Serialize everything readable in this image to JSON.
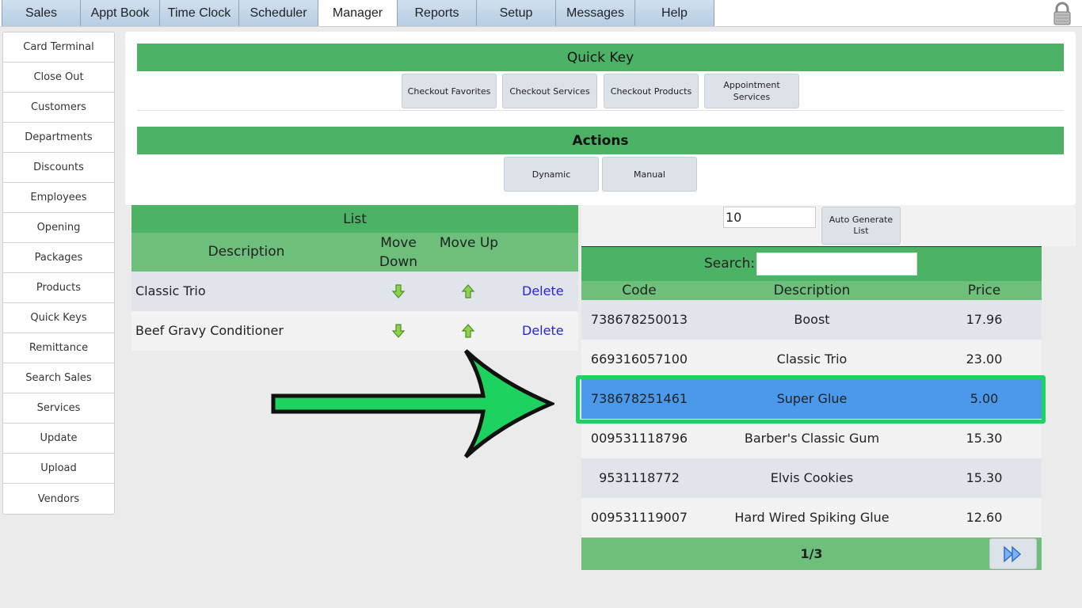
{
  "tabs": [
    "Sales",
    "Appt Book",
    "Time Clock",
    "Scheduler",
    "Manager",
    "Reports",
    "Setup",
    "Messages",
    "Help"
  ],
  "active_tab": "Manager",
  "sidebar": [
    "Card Terminal",
    "Close Out",
    "Customers",
    "Departments",
    "Discounts",
    "Employees",
    "Opening",
    "Packages",
    "Products",
    "Quick Keys",
    "Remittance",
    "Search Sales",
    "Services",
    "Update",
    "Upload",
    "Vendors"
  ],
  "quick_key": {
    "title": "Quick Key",
    "buttons": [
      "Checkout Favorites",
      "Checkout Services",
      "Checkout Products",
      "Appointment Services"
    ]
  },
  "actions": {
    "title": "Actions",
    "buttons": [
      "Dynamic",
      "Manual"
    ]
  },
  "list": {
    "title": "List",
    "col_description": "Description",
    "col_move_down": "Move Down",
    "col_move_up": "Move Up",
    "delete_label": "Delete",
    "rows": [
      "Classic Trio",
      "Beef Gravy Conditioner"
    ]
  },
  "generator": {
    "count_value": "10",
    "button": "Auto Generate List"
  },
  "products": {
    "search_label": "Search:",
    "search_value": "",
    "col_code": "Code",
    "col_description": "Description",
    "col_price": "Price",
    "rows": [
      {
        "code": "738678250013",
        "description": "Boost",
        "price": "17.96"
      },
      {
        "code": "669316057100",
        "description": "Classic Trio",
        "price": "23.00"
      },
      {
        "code": "738678251461",
        "description": "Super Glue",
        "price": "5.00"
      },
      {
        "code": "009531118796",
        "description": "Barber's Classic Gum",
        "price": "15.30"
      },
      {
        "code": "9531118772",
        "description": "Elvis Cookies",
        "price": "15.30"
      },
      {
        "code": "009531119007",
        "description": "Hard Wired Spiking Glue",
        "price": "12.60"
      }
    ],
    "selected_index": 2,
    "page": "1/3"
  },
  "colors": {
    "band_green": "#4cb265",
    "light_green": "#6dbf7b",
    "selected_blue": "#4a99ea",
    "highlight_green": "#1ed25f"
  }
}
